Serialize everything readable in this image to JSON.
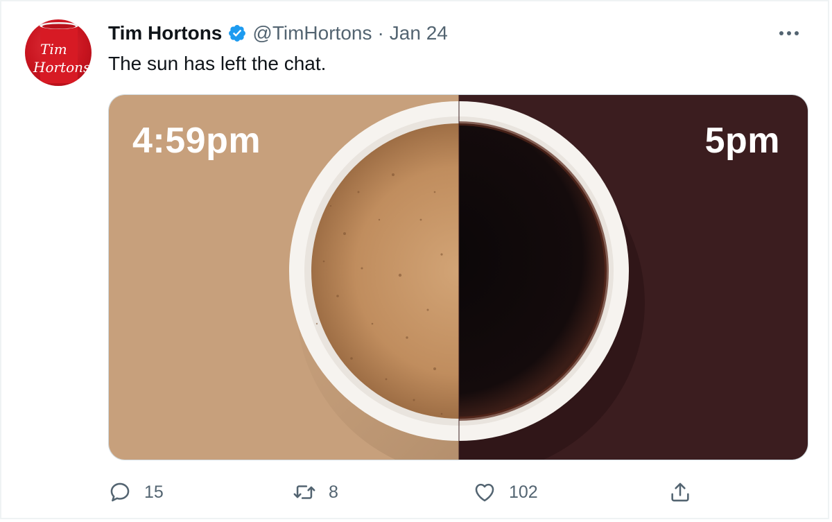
{
  "tweet": {
    "author_name": "Tim Hortons",
    "handle": "@TimHortons",
    "separator": "·",
    "date": "Jan 24",
    "text": "The sun has left the chat.",
    "avatar_logo_text": "Tim Hortons",
    "media": {
      "left_label": "4:59pm",
      "right_label": "5pm",
      "left_color": "#c7a07c",
      "right_color": "#3b1d1f"
    },
    "actions": {
      "replies": "15",
      "retweets": "8",
      "likes": "102"
    },
    "icons": {
      "verified": "verified-badge-icon",
      "more": "more-options-icon",
      "reply": "reply-icon",
      "retweet": "retweet-icon",
      "like": "heart-icon",
      "share": "share-icon"
    },
    "colors": {
      "brand_red": "#c8141f",
      "verified_blue": "#1d9bf0",
      "muted_text": "#536471"
    }
  }
}
